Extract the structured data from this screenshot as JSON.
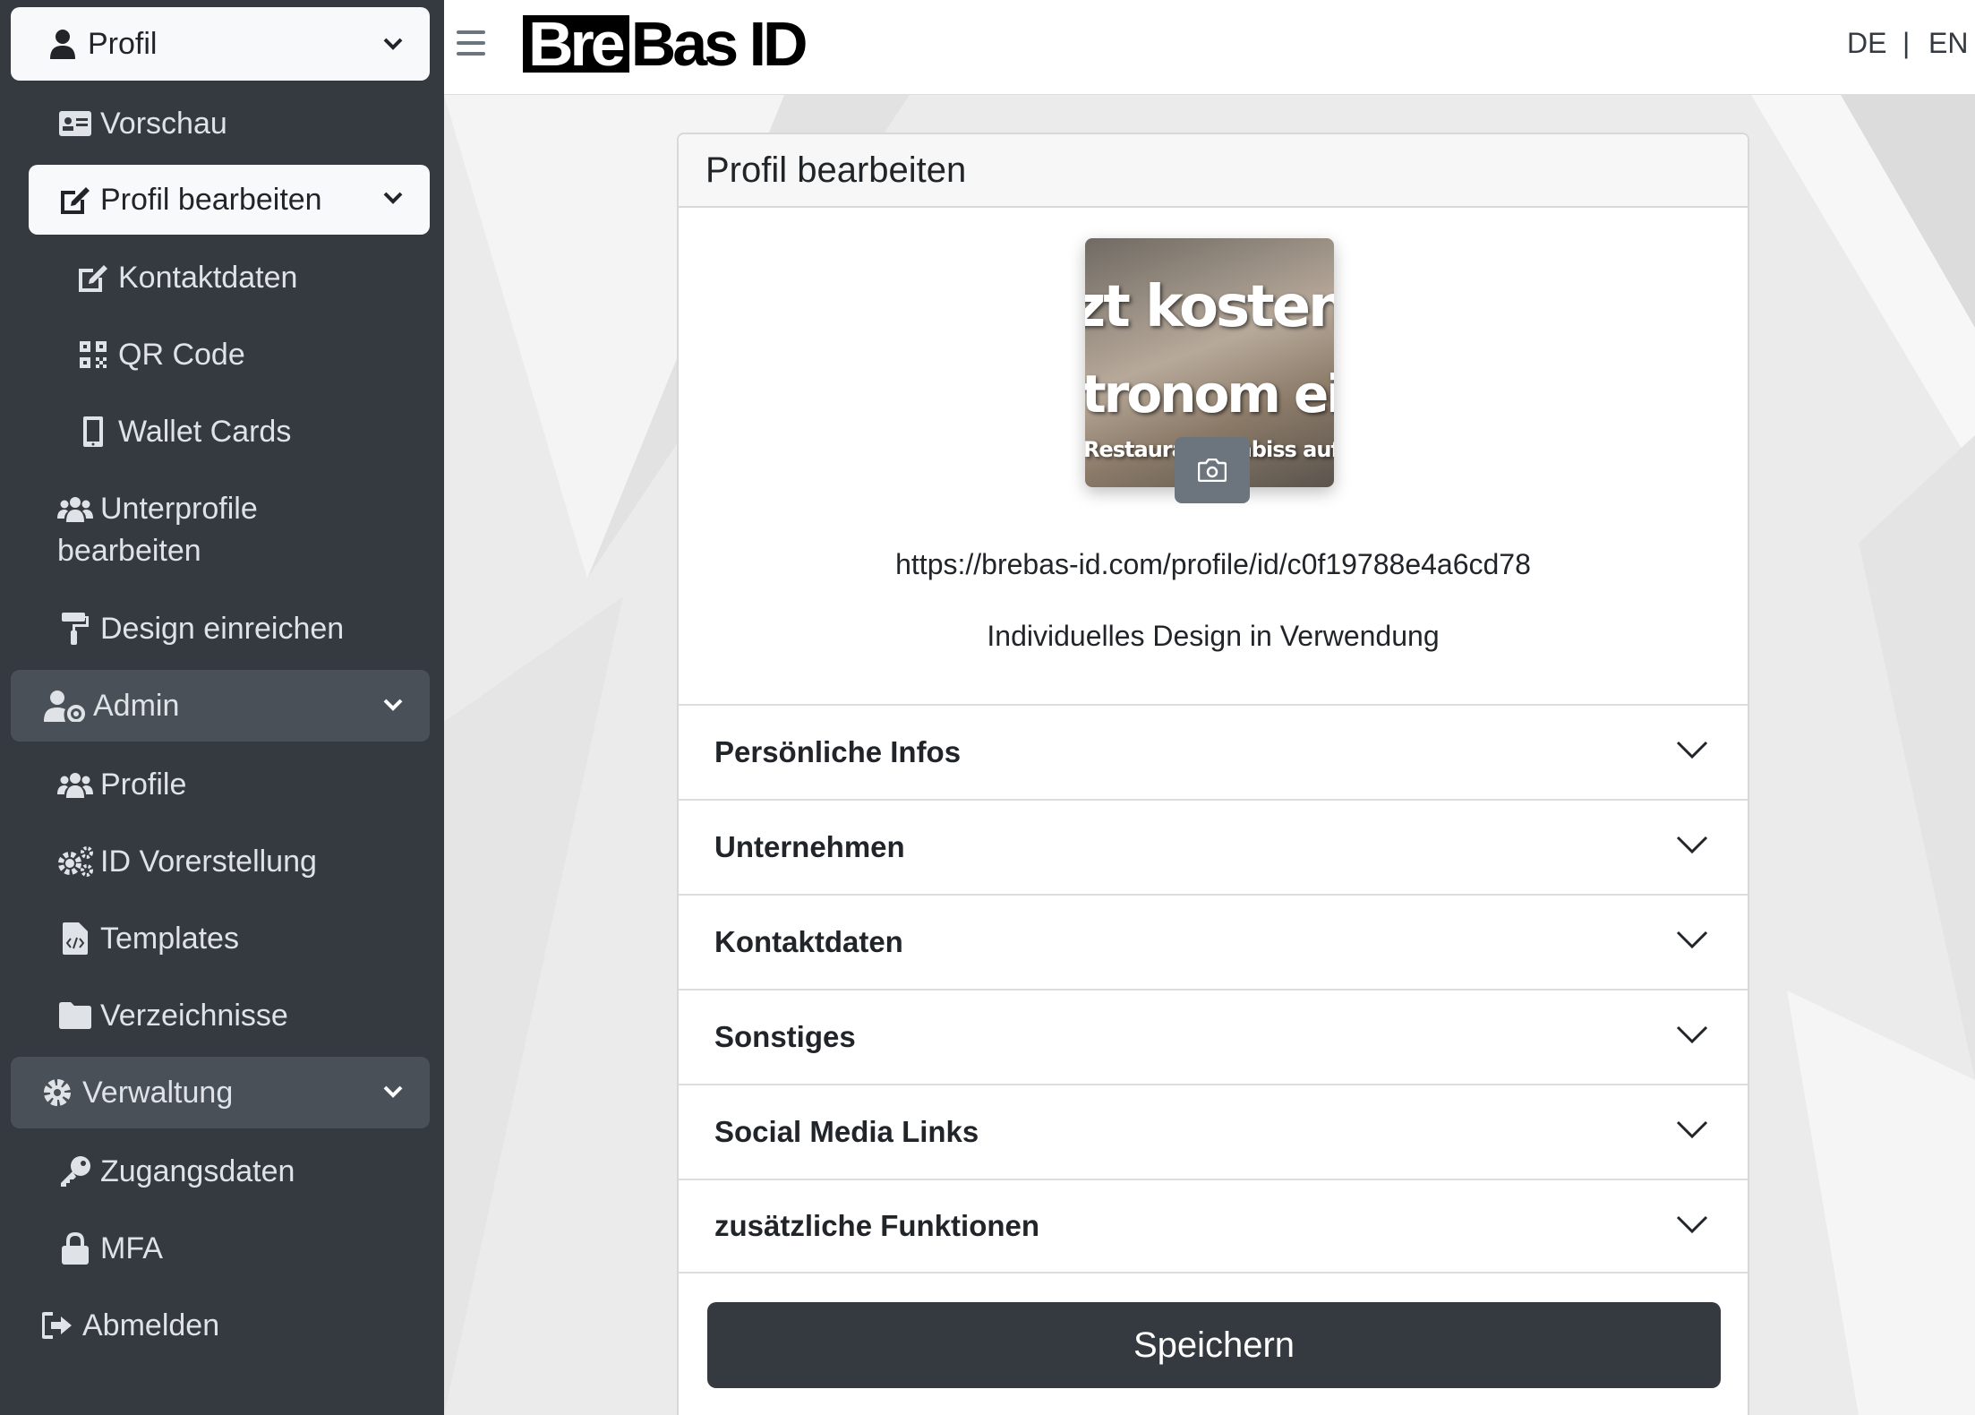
{
  "sidebar": {
    "profil": "Profil",
    "vorschau": "Vorschau",
    "profil_bearbeiten": "Profil bearbeiten",
    "kontaktdaten": "Kontaktdaten",
    "qr_code": "QR Code",
    "wallet_cards": "Wallet Cards",
    "unterprofile_line1": "Unterprofile",
    "unterprofile_line2": "bearbeiten",
    "design_einreichen": "Design einreichen",
    "admin": "Admin",
    "profile": "Profile",
    "id_vorerstellung": "ID Vorerstellung",
    "templates": "Templates",
    "verzeichnisse": "Verzeichnisse",
    "verwaltung": "Verwaltung",
    "zugangsdaten": "Zugangsdaten",
    "mfa": "MFA",
    "abmelden": "Abmelden"
  },
  "header": {
    "logo_box": "Bre",
    "logo_rest": "Bas ID",
    "lang_de": "DE",
    "lang_sep": "|",
    "lang_en": "EN"
  },
  "card": {
    "title": "Profil bearbeiten",
    "photo_text1": "zt kostenlos",
    "photo_text2": "tronom eintra",
    "photo_text3": "Restaurant, Imbiss auf der",
    "profile_url": "https://brebas-id.com/profile/id/c0f19788e4a6cd78",
    "design_status": "Individuelles Design in Verwendung",
    "sections": [
      "Persönliche Infos",
      "Unternehmen",
      "Kontaktdaten",
      "Sonstiges",
      "Social Media Links",
      "zusätzliche Funktionen"
    ],
    "save_label": "Speichern"
  },
  "icons": {
    "profil": "user-icon",
    "vorschau": "id-card-icon",
    "edit": "edit-icon",
    "qr": "qr-code-icon",
    "wallet": "mobile-icon",
    "users": "users-icon",
    "design": "paint-roller-icon",
    "admin": "user-cog-icon",
    "id": "cogs-icon",
    "templates": "file-code-icon",
    "folder": "folder-icon",
    "gear": "gear-icon",
    "key": "key-icon",
    "lock": "lock-icon",
    "logout": "sign-out-icon",
    "camera": "camera-icon",
    "menu": "hamburger-icon"
  },
  "colors": {
    "sidebar_bg": "#343a40",
    "active_light": "#f8f9fa",
    "active_dark": "#495057",
    "primary_button": "#343a40"
  }
}
